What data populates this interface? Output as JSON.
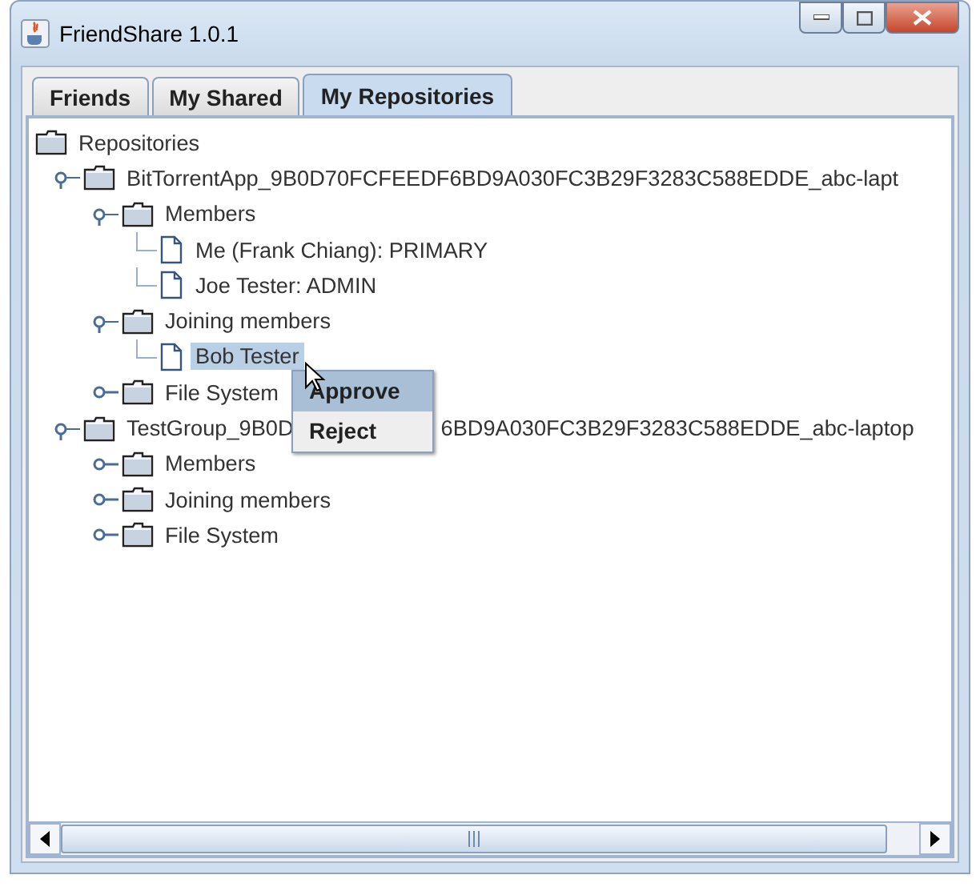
{
  "window": {
    "title": "FriendShare 1.0.1"
  },
  "tabs": [
    {
      "label": "Friends",
      "selected": false
    },
    {
      "label": "My Shared",
      "selected": false
    },
    {
      "label": "My Repositories",
      "selected": true
    }
  ],
  "tree": [
    {
      "kind": "root",
      "label": "Repositories",
      "children": [
        {
          "kind": "folder",
          "label": "BitTorrentApp_9B0D70FCFEEDF6BD9A030FC3B29F3283C588EDDE_abc-lapt",
          "expanded": true,
          "children": [
            {
              "kind": "folder",
              "label": "Members",
              "expanded": true,
              "children": [
                {
                  "kind": "file",
                  "label": "Me (Frank Chiang): PRIMARY",
                  "selected": false
                },
                {
                  "kind": "file",
                  "label": "Joe Tester: ADMIN",
                  "selected": false
                }
              ]
            },
            {
              "kind": "folder",
              "label": "Joining members",
              "expanded": true,
              "children": [
                {
                  "kind": "file",
                  "label": "Bob Tester",
                  "selected": true
                }
              ]
            },
            {
              "kind": "folder",
              "label": "File System",
              "expanded": false
            }
          ]
        },
        {
          "kind": "folder",
          "label": "TestGroup_9B0D",
          "label_after_menu": "6BD9A030FC3B29F3283C588EDDE_abc-laptop",
          "expanded": true,
          "children": [
            {
              "kind": "folder",
              "label": "Members",
              "expanded": false
            },
            {
              "kind": "folder",
              "label": "Joining members",
              "expanded": false
            },
            {
              "kind": "folder",
              "label": "File System",
              "expanded": false
            }
          ]
        }
      ]
    }
  ],
  "context_menu": [
    {
      "label": "Approve",
      "selected": true
    },
    {
      "label": "Reject",
      "selected": false
    }
  ]
}
